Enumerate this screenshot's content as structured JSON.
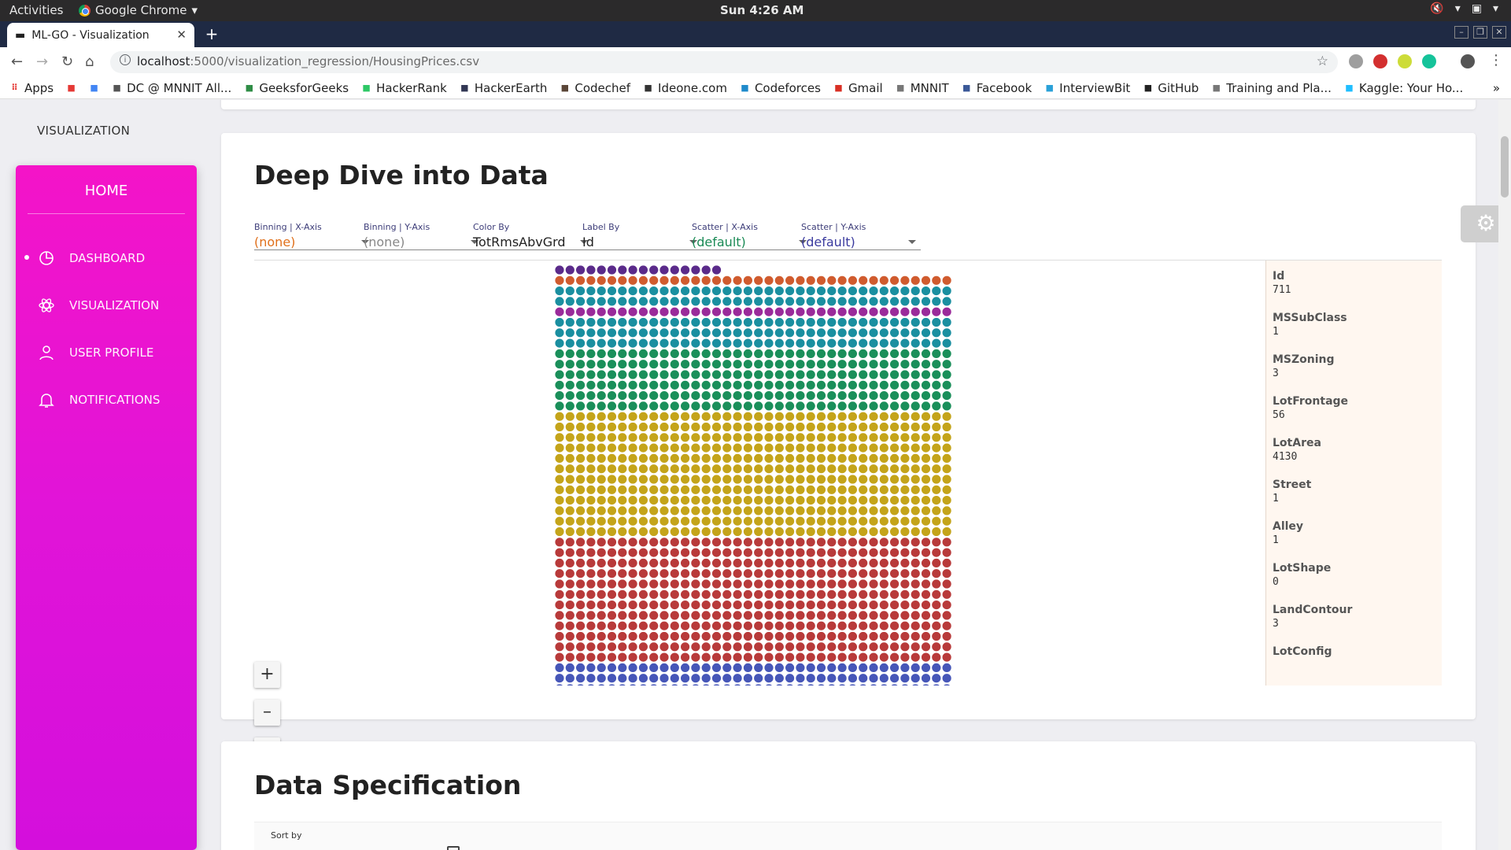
{
  "os_bar": {
    "activities": "Activities",
    "app_name": "Google Chrome",
    "clock": "Sun  4:26 AM"
  },
  "browser": {
    "tab_title": "ML-GO - Visualization",
    "url_host": "localhost",
    "url_path": ":5000/visualization_regression/HousingPrices.csv"
  },
  "bookmarks": [
    {
      "label": "Apps",
      "icon": "apps-grid-icon",
      "color": "#e53935"
    },
    {
      "label": "",
      "icon": "youtube-icon",
      "color": "#e53935"
    },
    {
      "label": "",
      "icon": "google-icon",
      "color": "#4285f4"
    },
    {
      "label": "DC @ MNNIT All...",
      "icon": "page-icon",
      "color": "#555555"
    },
    {
      "label": "GeeksforGeeks",
      "icon": "geeksforgeeks-icon",
      "color": "#2f8d46"
    },
    {
      "label": "HackerRank",
      "icon": "hackerrank-icon",
      "color": "#2ec866"
    },
    {
      "label": "HackerEarth",
      "icon": "hackerearth-icon",
      "color": "#323754"
    },
    {
      "label": "Codechef",
      "icon": "codechef-icon",
      "color": "#5b4638"
    },
    {
      "label": "Ideone.com",
      "icon": "ideone-icon",
      "color": "#333333"
    },
    {
      "label": "Codeforces",
      "icon": "codeforces-icon",
      "color": "#1f8acb"
    },
    {
      "label": "Gmail",
      "icon": "gmail-icon",
      "color": "#d93025"
    },
    {
      "label": "MNNIT",
      "icon": "mnnit-icon",
      "color": "#777777"
    },
    {
      "label": "Facebook",
      "icon": "facebook-icon",
      "color": "#3b5998"
    },
    {
      "label": "InterviewBit",
      "icon": "interviewbit-icon",
      "color": "#2aa1d8"
    },
    {
      "label": "GitHub",
      "icon": "github-icon",
      "color": "#222222"
    },
    {
      "label": "Training and Pla...",
      "icon": "globe-icon",
      "color": "#777777"
    },
    {
      "label": "Kaggle: Your Ho...",
      "icon": "kaggle-icon",
      "color": "#20beff"
    }
  ],
  "app": {
    "brand": "VISUALIZATION",
    "sidebar": {
      "home": "HOME",
      "items": [
        {
          "label": "DASHBOARD",
          "icon": "pie-chart-icon",
          "active": true
        },
        {
          "label": "VISUALIZATION",
          "icon": "atom-icon",
          "active": false
        },
        {
          "label": "USER PROFILE",
          "icon": "user-icon",
          "active": false
        },
        {
          "label": "NOTIFICATIONS",
          "icon": "bell-icon",
          "active": false
        }
      ]
    },
    "deep_dive": {
      "title": "Deep Dive into Data",
      "controls": [
        {
          "label": "Binning | X-Axis",
          "value": "(none)",
          "color": "#e0701b"
        },
        {
          "label": "Binning | Y-Axis",
          "value": "(none)",
          "color": "#888888"
        },
        {
          "label": "Color By",
          "value": "TotRmsAbvGrd",
          "color": "#222222"
        },
        {
          "label": "Label By",
          "value": "Id",
          "color": "#222222"
        },
        {
          "label": "Scatter | X-Axis",
          "value": "(default)",
          "color": "#1a8a55"
        },
        {
          "label": "Scatter | Y-Axis",
          "value": "(default)",
          "color": "#3a3a9e"
        }
      ],
      "zoom_in": "+",
      "zoom_out": "–",
      "fit_icon": "fit-screen-icon",
      "grid_colors": [
        "#4656b8",
        "#b83a3a",
        "#c4a41a",
        "#1a8f5a",
        "#9a2a9a",
        "#1a8fa0",
        "#d05b2e",
        "#7d9a2a",
        "#5a2a8a"
      ],
      "selected": {
        "fields": [
          {
            "key": "Id",
            "value": "711"
          },
          {
            "key": "MSSubClass",
            "value": "1"
          },
          {
            "key": "MSZoning",
            "value": "3"
          },
          {
            "key": "LotFrontage",
            "value": "56"
          },
          {
            "key": "LotArea",
            "value": "4130"
          },
          {
            "key": "Street",
            "value": "1"
          },
          {
            "key": "Alley",
            "value": "1"
          },
          {
            "key": "LotShape",
            "value": "0"
          },
          {
            "key": "LandContour",
            "value": "3"
          },
          {
            "key": "LotConfig",
            "value": ""
          }
        ]
      }
    },
    "data_spec": {
      "title": "Data Specification",
      "sort_label": "Sort by"
    }
  }
}
